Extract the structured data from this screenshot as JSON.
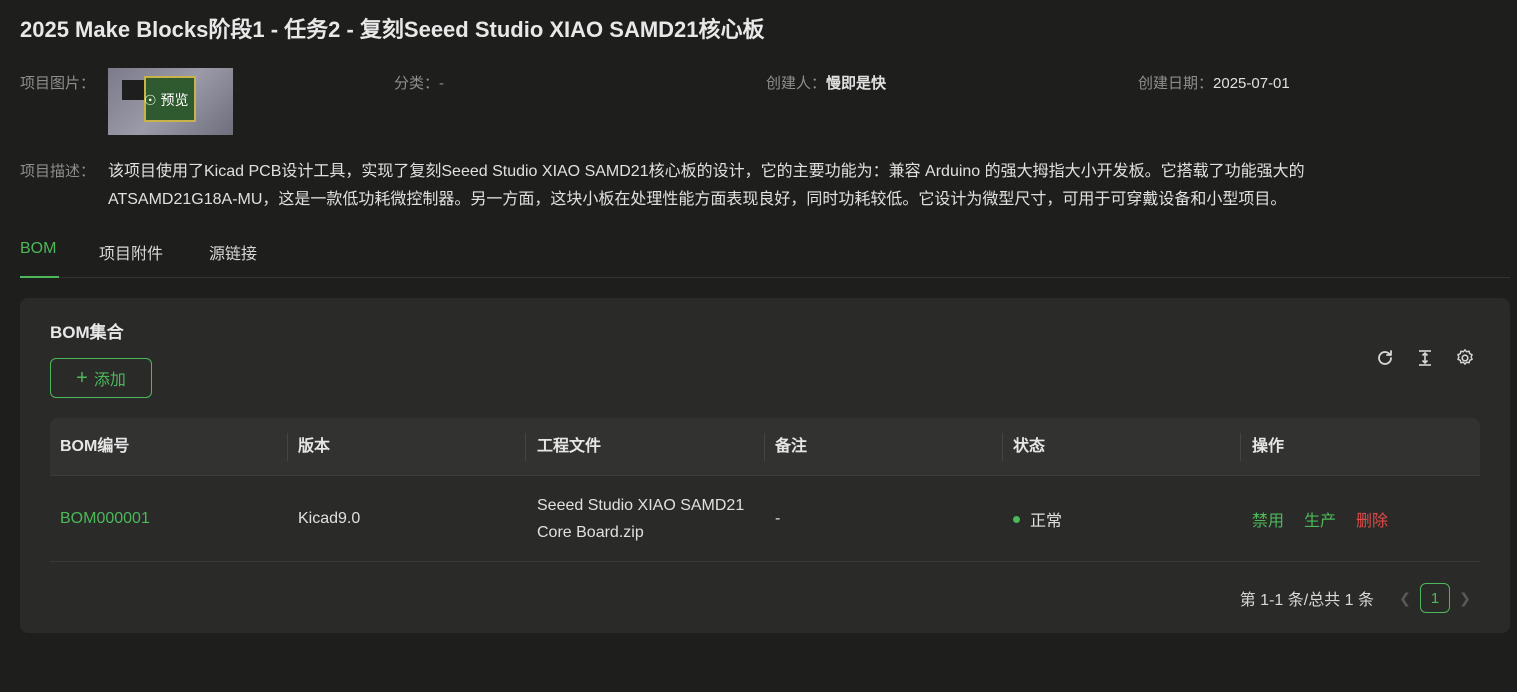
{
  "title": "2025 Make Blocks阶段1 - 任务2 - 复刻Seeed Studio XIAO SAMD21核心板",
  "meta": {
    "image_label": "项目图片：",
    "image_overlay": "预览",
    "category_label": "分类：",
    "category_value": "-",
    "creator_label": "创建人：",
    "creator_value": "慢即是快",
    "date_label": "创建日期：",
    "date_value": "2025-07-01"
  },
  "description": {
    "label": "项目描述：",
    "text": "该项目使用了Kicad PCB设计工具，实现了复刻Seeed Studio XIAO SAMD21核心板的设计，它的主要功能为：兼容 Arduino 的强大拇指大小开发板。它搭载了功能强大的ATSAMD21G18A-MU，这是一款低功耗微控制器。另一方面，这块小板在处理性能方面表现良好，同时功耗较低。它设计为微型尺寸，可用于可穿戴设备和小型项目。"
  },
  "tabs": [
    {
      "label": "BOM",
      "active": true
    },
    {
      "label": "项目附件",
      "active": false
    },
    {
      "label": "源链接",
      "active": false
    }
  ],
  "bom": {
    "card_title": "BOM集合",
    "add_label": "添加",
    "columns": [
      "BOM编号",
      "版本",
      "工程文件",
      "备注",
      "状态",
      "操作"
    ],
    "rows": [
      {
        "id": "BOM000001",
        "version": "Kicad9.0",
        "file": "Seeed Studio XIAO SAMD21 Core Board.zip",
        "note": "-",
        "status": "正常",
        "actions": {
          "disable": "禁用",
          "produce": "生产",
          "delete": "删除"
        }
      }
    ],
    "pagination": {
      "summary": "第 1-1 条/总共 1 条",
      "current_page": "1",
      "prev_icon": "chevron-left-icon",
      "next_icon": "chevron-right-icon"
    },
    "toolbar_icons": [
      "reload-icon",
      "column-height-icon",
      "settings-icon"
    ]
  },
  "colors": {
    "accent": "#4cb85a",
    "danger": "#e04a4a",
    "background": "#1e1e1c",
    "card": "#2a2a28"
  }
}
